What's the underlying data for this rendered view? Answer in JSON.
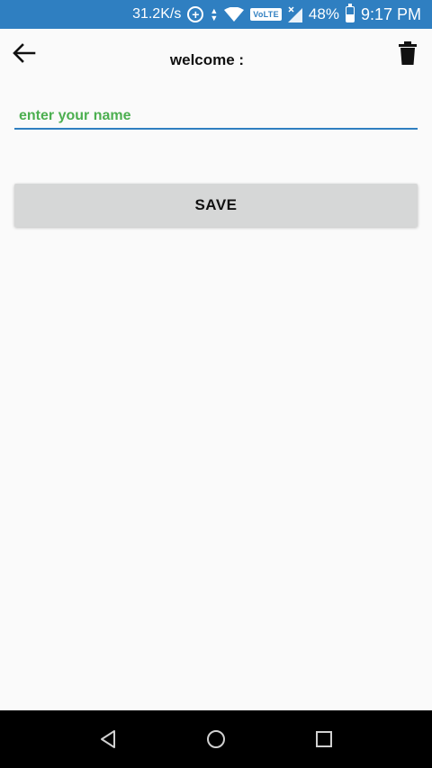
{
  "status_bar": {
    "net_speed": "31.2K/s",
    "volte": "VoLTE",
    "battery_percent": "48%",
    "battery_level": 0.48,
    "time": "9:17 PM",
    "background_color": "#2f7fc1",
    "icons": [
      "data-saver-icon",
      "sync-arrows-icon",
      "wifi-icon",
      "volte-badge",
      "signal-icon",
      "battery-icon"
    ]
  },
  "app_bar": {
    "title": "welcome :",
    "back_icon": "arrow-left-icon",
    "delete_icon": "trash-icon"
  },
  "form": {
    "name_placeholder": "enter your name",
    "name_value": "",
    "save_label": "SAVE",
    "accent_color": "#2f7fc1",
    "placeholder_color": "#4caf50"
  },
  "nav_bar": {
    "icons": [
      "back-triangle-icon",
      "home-circle-icon",
      "recents-square-icon"
    ]
  }
}
